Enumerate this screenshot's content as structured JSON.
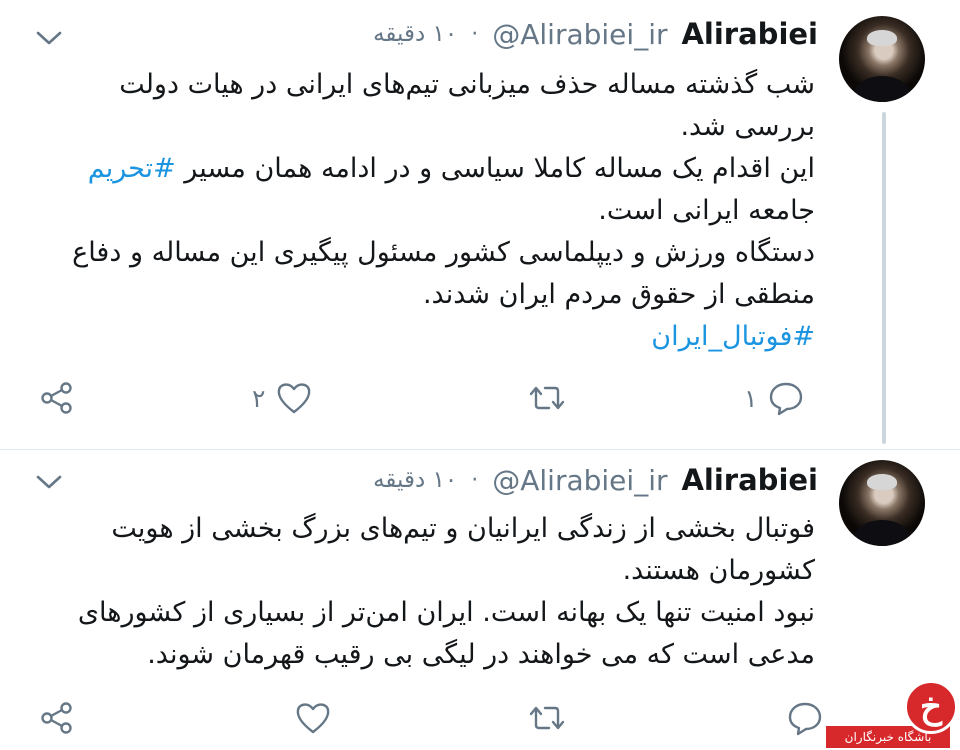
{
  "tweets": [
    {
      "author_name": "Alirabiei",
      "handle": "@Alirabiei_ir",
      "separator": "·",
      "time": "۱۰ دقیقه",
      "lines": [
        "شب گذشته مساله حذف میزبانی تیم‌های ایرانی در هیات دولت",
        "بررسی شد.",
        "این اقدام یک مساله کاملا سیاسی و در ادامه همان مسیر",
        "جامعه ایرانی است.",
        "دستگاه ورزش و دیپلماسی کشور مسئول پیگیری این مساله و دفاع",
        "منطقی از حقوق مردم ایران شدند."
      ],
      "hashtag_inline": "#تحریم",
      "hashtag_line": "#فوتبال_ایران",
      "actions": {
        "reply_count": "۱",
        "retweet_count": "",
        "like_count": "۲"
      }
    },
    {
      "author_name": "Alirabiei",
      "handle": "@Alirabiei_ir",
      "separator": "·",
      "time": "۱۰ دقیقه",
      "lines": [
        "فوتبال بخشی از زندگی ایرانیان و تیم‌های بزرگ  بخشی از هویت",
        "کشورمان هستند.",
        "نبود امنیت تنها یک بهانه است. ایران امن‌تر از بسیاری از کشورهای",
        "مدعی است که می خواهند در لیگی بی رقیب قهرمان شوند."
      ],
      "actions": {
        "reply_count": "",
        "retweet_count": "",
        "like_count": ""
      }
    }
  ],
  "icons": {
    "reply": "reply-icon",
    "retweet": "retweet-icon",
    "like": "heart-icon",
    "share": "share-icon",
    "menu": "chevron-down-icon"
  },
  "colors": {
    "text": "#14171a",
    "secondary": "#657786",
    "link": "#1b95e0",
    "divider": "#e1e8ed",
    "watermark": "#d7282c"
  },
  "watermark": {
    "logo_letter": "خ",
    "caption": "باشگاه خبرنگاران"
  }
}
